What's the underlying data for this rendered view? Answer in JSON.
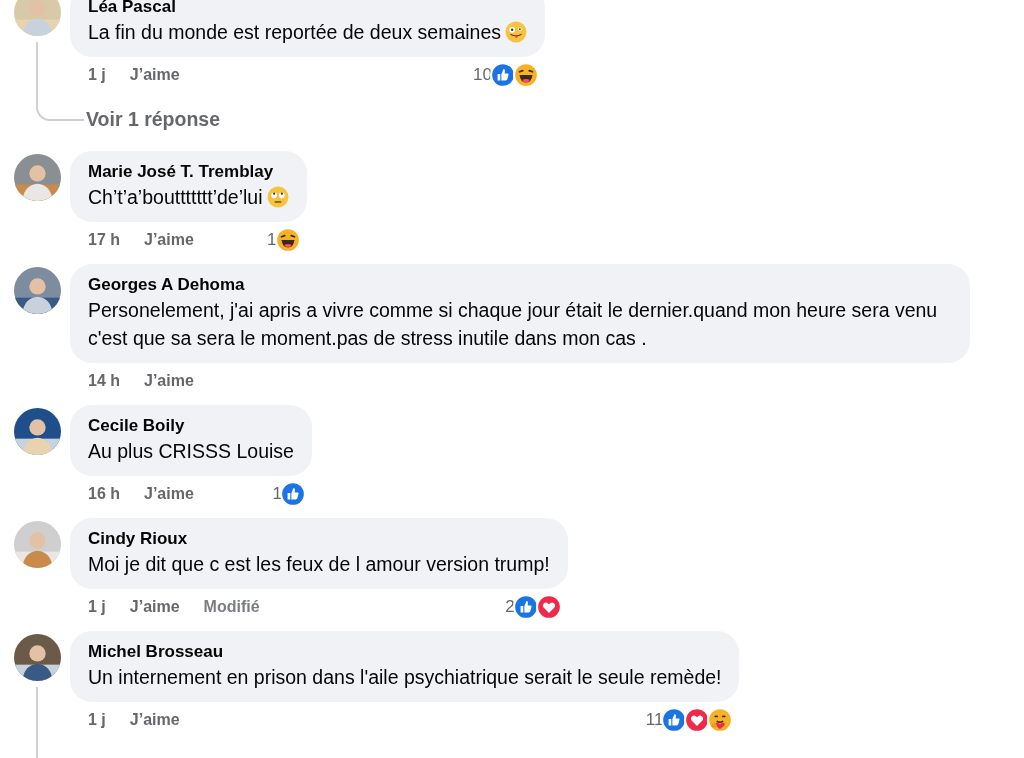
{
  "comments": [
    {
      "name": "Léa Pascal",
      "text": "La fin du monde est reportée de deux semaines",
      "emoji": {
        "kind": "silly"
      },
      "time": "1 j",
      "like_label": "J’aime",
      "reaction_count": "10",
      "reactions": [
        {
          "kind": "like"
        },
        {
          "kind": "haha"
        }
      ],
      "thread": true,
      "replies_link": "Voir 1 réponse"
    },
    {
      "name": "Marie José T. Tremblay",
      "text": "Ch’t’a’bouttttttt’de’lui",
      "emoji": {
        "kind": "eye-roll"
      },
      "time": "17 h",
      "like_label": "J’aime",
      "reaction_count": "1",
      "reactions": [
        {
          "kind": "haha"
        }
      ],
      "thread": false
    },
    {
      "name": "Georges A Dehoma",
      "text": "Personelement, j'ai apris a vivre comme si chaque jour était le dernier.quand mon heure sera venu c'est que sa sera le moment.pas de stress inutile dans mon cas .",
      "time": "14 h",
      "like_label": "J’aime",
      "thread": false
    },
    {
      "name": "Cecile Boily",
      "text": "Au plus CRISSS Louise",
      "time": "16 h",
      "like_label": "J’aime",
      "reaction_count": "1",
      "reactions": [
        {
          "kind": "like"
        }
      ],
      "thread": false
    },
    {
      "name": "Cindy Rioux",
      "text": "Moi je dit que c est les feux de l amour version trump!",
      "time": "1 j",
      "like_label": "J’aime",
      "edited_label": "Modifié",
      "reaction_count": "2",
      "reactions": [
        {
          "kind": "like"
        },
        {
          "kind": "love"
        }
      ],
      "thread": false
    },
    {
      "name": "Michel Brosseau",
      "text": "Un internement en prison dans l'aile psychiatrique serait le seule remède!",
      "time": "1 j",
      "like_label": "J’aime",
      "reaction_count": "11",
      "reactions": [
        {
          "kind": "like"
        },
        {
          "kind": "love"
        },
        {
          "kind": "care"
        }
      ],
      "thread": true
    }
  ]
}
